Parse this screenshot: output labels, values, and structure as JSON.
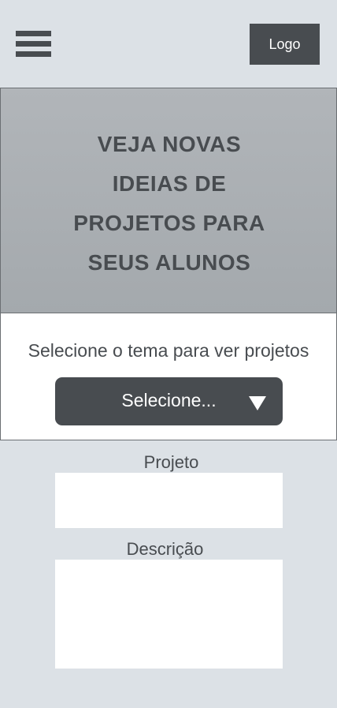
{
  "header": {
    "menu_icon": "hamburger-menu-icon",
    "logo_label": "Logo"
  },
  "hero": {
    "title_lines": [
      "VEJA NOVAS",
      "IDEIAS DE",
      "PROJETOS PARA",
      "SEUS ALUNOS"
    ]
  },
  "theme_selector": {
    "prompt": "Selecione o tema para ver projetos",
    "selected_value": "Selecione...",
    "arrow_icon": "chevron-down-icon"
  },
  "form": {
    "project_label": "Projeto",
    "project_value": "",
    "description_label": "Descrição",
    "description_value": ""
  },
  "colors": {
    "page_background": "#dce1e6",
    "dark": "#484c50",
    "hero_background": "#a9aeb2",
    "white": "#ffffff"
  }
}
